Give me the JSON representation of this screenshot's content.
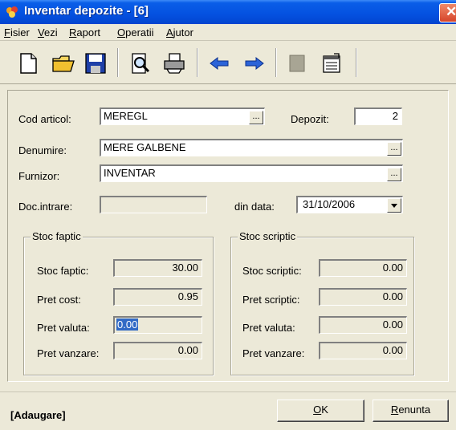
{
  "window": {
    "title": "Inventar depozite - [6]"
  },
  "menu": [
    {
      "accel": "F",
      "rest": "isier"
    },
    {
      "accel": "V",
      "rest": "ezi"
    },
    {
      "accel": "R",
      "rest": "aport"
    },
    {
      "accel": "O",
      "rest": "peratii"
    },
    {
      "accel": "A",
      "rest": "jutor"
    }
  ],
  "toolbar": [
    "new-doc-icon",
    "open-folder-icon",
    "save-icon",
    "print-preview-icon",
    "print-icon",
    "arrow-left-icon",
    "arrow-right-icon",
    "stop-icon",
    "properties-icon"
  ],
  "form": {
    "cod_articol_label": "Cod articol:",
    "cod_articol_value": "MEREGL",
    "depozit_label": "Depozit:",
    "depozit_value": "2",
    "denumire_label": "Denumire:",
    "denumire_value": "MERE GALBENE",
    "furnizor_label": "Furnizor:",
    "furnizor_value": "INVENTAR",
    "doc_intrare_label": "Doc.intrare:",
    "doc_intrare_value": "",
    "din_data_label": "din data:",
    "din_data_value": "31/10/2006",
    "lookup_label": "..."
  },
  "stoc_faptic": {
    "title": "Stoc faptic",
    "stoc_label": "Stoc faptic:",
    "stoc_value": "30.00",
    "pret_cost_label": "Pret cost:",
    "pret_cost_value": "0.95",
    "pret_valuta_label": "Pret valuta:",
    "pret_valuta_value": "0.00",
    "pret_vanzare_label": "Pret vanzare:",
    "pret_vanzare_value": "0.00"
  },
  "stoc_scriptic": {
    "title": "Stoc scriptic",
    "stoc_label": "Stoc scriptic:",
    "stoc_value": "0.00",
    "pret_scriptic_label": "Pret scriptic:",
    "pret_scriptic_value": "0.00",
    "pret_valuta_label": "Pret valuta:",
    "pret_valuta_value": "0.00",
    "pret_vanzare_label": "Pret vanzare:",
    "pret_vanzare_value": "0.00"
  },
  "status": "[Adaugare]",
  "buttons": {
    "ok_accel": "O",
    "ok_rest": "K",
    "cancel_accel": "R",
    "cancel_rest": "enunta"
  }
}
